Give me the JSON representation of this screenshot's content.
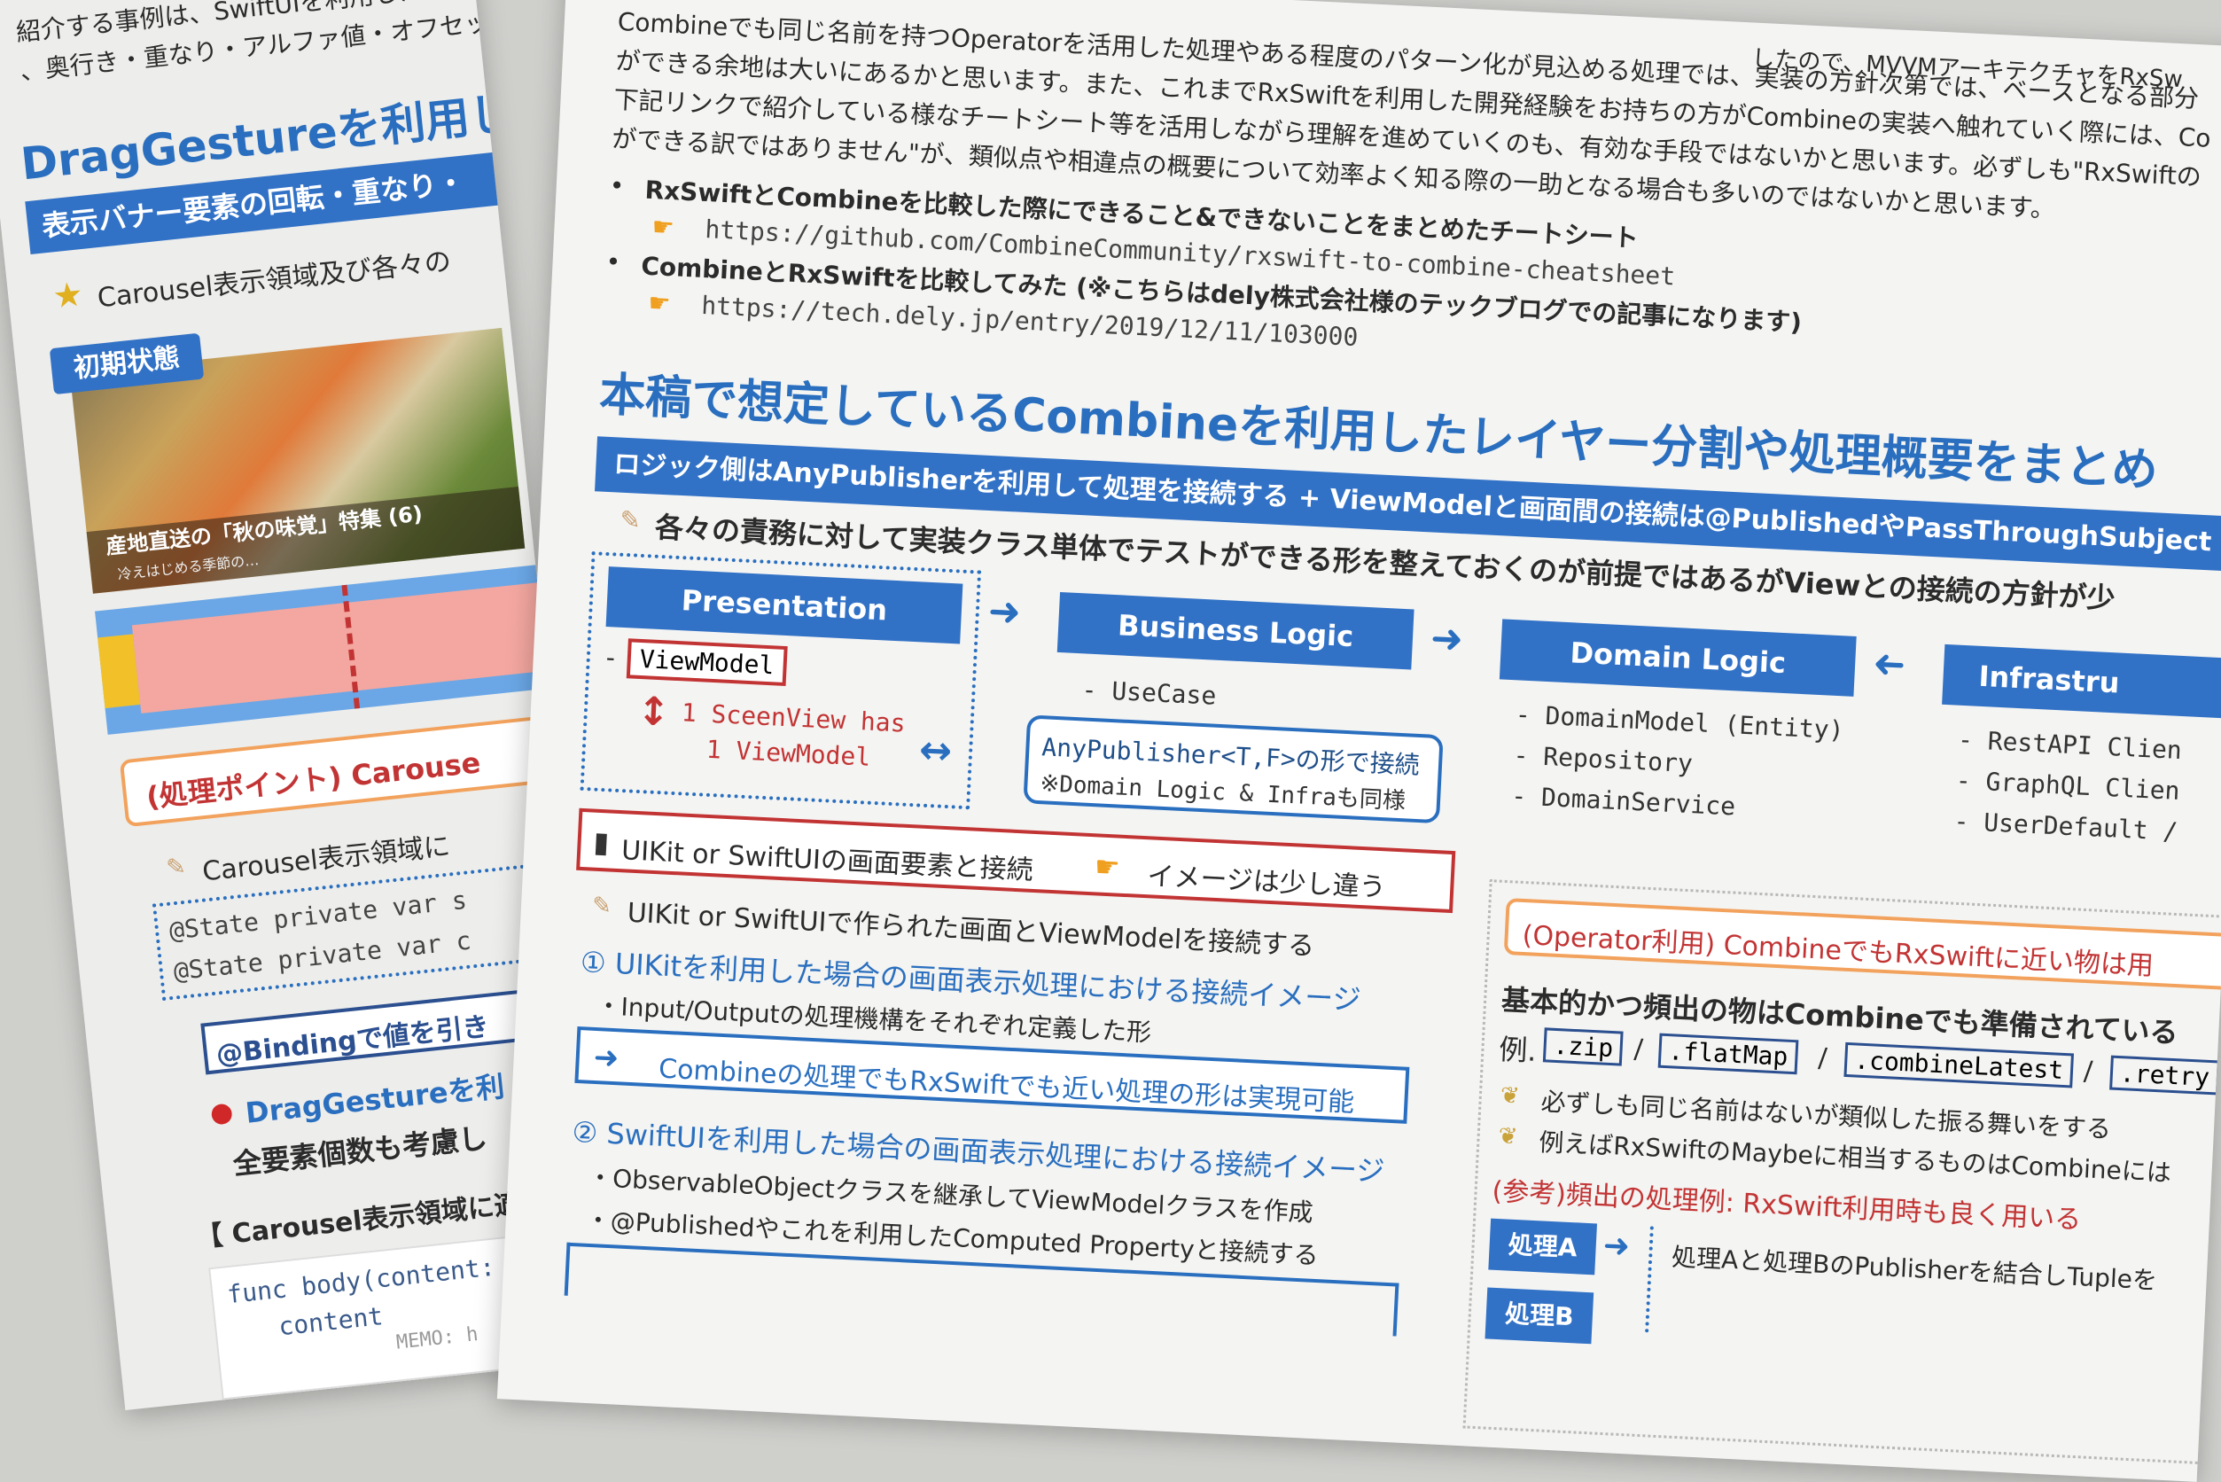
{
  "left_sheet": {
    "intro_line1": "紹介する事例は、SwiftUIを利用した画面",
    "intro_line2": "、奥行き・重なり・アルファ値・オフセット",
    "heading": "DragGestureを利用した",
    "banner": "表示バナー要素の回転・重なり・",
    "star_line": "Carousel表示領域及び各々の",
    "initial_state": "初期状態",
    "photo_caption": "産地直送の「秋の味覚」特集 (6)",
    "photo_caption_small": "冷えはじめる季節の…",
    "point_box": "(処理ポイント) Carouse",
    "bullet_carousel": "Carousel表示領域に",
    "code_state1": "@State private var s",
    "code_state2": "@State private var c",
    "binding_box": "@Bindingで値を引き",
    "drag_line": "DragGestureを利",
    "all_elements": "全要素個数も考慮し",
    "carousel_apply": "【 Carousel表示領域に適",
    "code_func": "func body(content:",
    "code_content": "content",
    "code_memo": "MEMO: h"
  },
  "main_sheet": {
    "top_cut_right": "したので、MVVMアーキテクチャをRxSw",
    "para_line0": "Combineでも同じ名前を持つOperatorを活用した処理やある程度のパターン化が見込める処理では、実装の方針次第では、ベースとなる部分",
    "para_line1": "ができる余地は大いにあるかと思います。また、これまでRxSwiftを利用した開発経験をお持ちの方がCombineの実装へ触れていく際には、Co",
    "para_line2": "下記リンクで紹介している様なチートシート等を活用しながら理解を進めていくのも、有効な手段ではないかと思います。必ずしも\"RxSwiftの",
    "para_line3": "ができる訳ではありません\"が、類似点や相違点の概要について効率よく知る際の一助となる場合も多いのではないかと思います。",
    "bullet1_title": "RxSwiftとCombineを比較した際にできること&できないことをまとめたチートシート",
    "bullet1_url": "https://github.com/CombineCommunity/rxswift-to-combine-cheatsheet",
    "bullet2_title": "CombineとRxSwiftを比較してみた (※こちらはdely株式会社様のテックブログでの記事になります)",
    "bullet2_url": "https://tech.dely.jp/entry/2019/12/11/103000",
    "section_title": "本稿で想定しているCombineを利用したレイヤー分割や処理概要をまとめ",
    "blue_banner": "ロジック側はAnyPublisherを利用して処理を接続する + ViewModelと画面間の接続は@PublishedやPassThroughSubject",
    "responsibility_line": "各々の責務に対して実装クラス単体でテストができる形を整えておくのが前提ではあるがViewとの接続の方針が少",
    "layers": {
      "presentation": "Presentation",
      "business": "Business Logic",
      "domain": "Domain Logic",
      "infra": "Infrastru"
    },
    "viewmodel_dash": "-",
    "viewmodel": "ViewModel",
    "sceenview_line1": "1 SceenView has",
    "sceenview_line2": "1 ViewModel",
    "usecase": "- UseCase",
    "anypub_line1": "AnyPublisher<T,F>の形で接続",
    "anypub_line2": "※Domain Logic & Infraも同様",
    "domain_items": [
      "- DomainModel (Entity)",
      "- Repository",
      "- DomainService"
    ],
    "infra_items": [
      "- RestAPI Clien",
      "- GraphQL Clien",
      "- UserDefault /"
    ],
    "uikit_box": "UIKit or SwiftUIの画面要素と接続",
    "image_diff": "イメージは少し違う",
    "uikit_line": "UIKit or SwiftUIで作られた画面とViewModelを接続する",
    "item1_title": "① UIKitを利用した場合の画面表示処理における接続イメージ",
    "item1_sub": "・Input/Outputの処理機構をそれぞれ定義した形",
    "item1_box": "Combineの処理でもRxSwiftでも近い処理の形は実現可能",
    "item2_title": "② SwiftUIを利用した場合の画面表示処理における接続イメージ",
    "item2_sub1": "・ObservableObjectクラスを継承してViewModelクラスを作成",
    "item2_sub2": "・@Publishedやこれを利用したComputed Propertyと接続する",
    "operator_box": "(Operator利用) CombineでもRxSwiftに近い物は用",
    "basic_line": "基本的かつ頻出の物はCombineでも準備されている",
    "example_prefix": "例.",
    "ops": [
      ".zip",
      ".flatMap",
      ".combineLatest",
      ".retry"
    ],
    "op_sep": "/",
    "not_same": "必ずしも同じ名前はないが類似した振る舞いをする",
    "maybe_line": "例えばRxSwiftのMaybeに相当するものはCombineには",
    "ref_line": "(参考)頻出の処理例: RxSwift利用時も良く用いる",
    "proc_a": "処理A",
    "proc_b": "処理B",
    "combine_ab": "処理Aと処理BのPublisherを結合しTupleを"
  }
}
